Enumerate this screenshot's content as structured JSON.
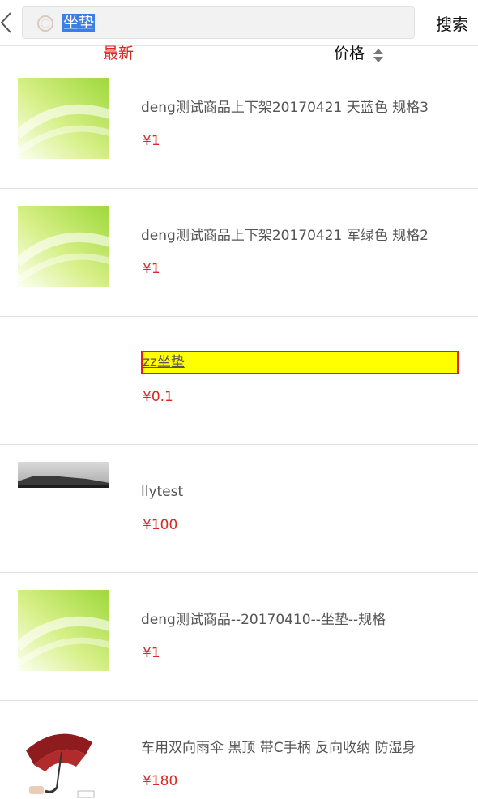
{
  "header": {
    "search_value": "坐垫",
    "search_button_label": "搜索"
  },
  "sort": {
    "newest_label": "最新",
    "price_label": "价格"
  },
  "products": [
    {
      "title": "deng测试商品上下架20170421 天蓝色 规格3",
      "price": "¥1",
      "thumb": "gradient"
    },
    {
      "title": "deng测试商品上下架20170421 军绿色 规格2",
      "price": "¥1",
      "thumb": "gradient"
    },
    {
      "title": "zz坐垫",
      "price": "¥0.1",
      "thumb": "none"
    },
    {
      "title": "llytest",
      "price": "¥100",
      "thumb": "landscape"
    },
    {
      "title": "deng测试商品--20170410--坐垫--规格",
      "price": "¥1",
      "thumb": "gradient"
    },
    {
      "title": "车用双向雨伞 黑顶 带C手柄 反向收纳 防湿身",
      "price": "¥180",
      "thumb": "umbrella"
    }
  ],
  "colors": {
    "accent_red": "#d9281f",
    "highlight_yellow": "#ffff00",
    "selection_blue": "#3d7ee6"
  }
}
